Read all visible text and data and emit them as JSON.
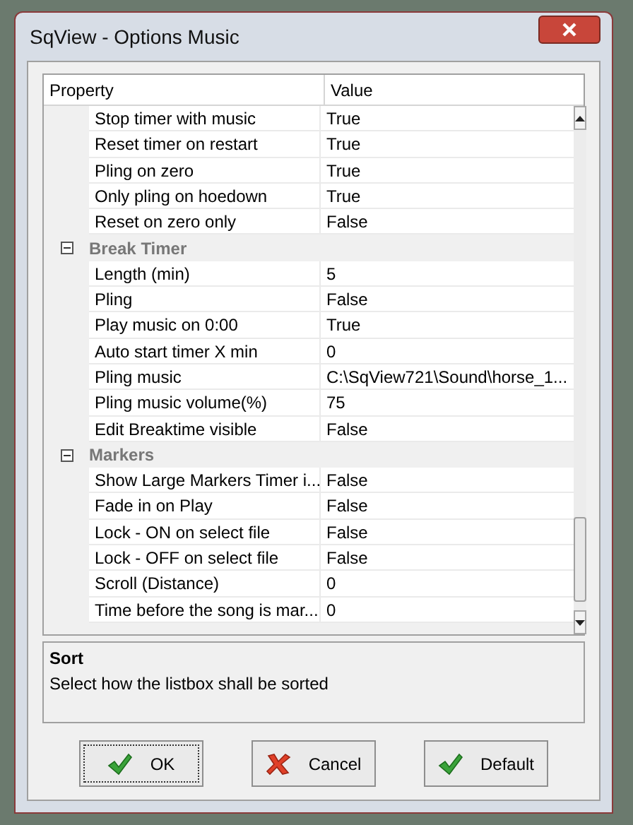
{
  "window": {
    "title": "SqView - Options Music"
  },
  "grid": {
    "columns": [
      "Property",
      "Value"
    ],
    "rows": [
      {
        "kind": "property",
        "name": "Stop timer with music",
        "value": "True"
      },
      {
        "kind": "property",
        "name": "Reset timer on restart",
        "value": "True"
      },
      {
        "kind": "property",
        "name": "Pling on zero",
        "value": "True"
      },
      {
        "kind": "property",
        "name": "Only pling on hoedown",
        "value": "True"
      },
      {
        "kind": "property",
        "name": "Reset on zero only",
        "value": "False"
      },
      {
        "kind": "category",
        "name": "Break Timer",
        "expanded": true
      },
      {
        "kind": "property",
        "name": "Length (min)",
        "value": "5"
      },
      {
        "kind": "property",
        "name": "Pling",
        "value": "False"
      },
      {
        "kind": "property",
        "name": "Play music on 0:00",
        "value": "True"
      },
      {
        "kind": "property",
        "name": "Auto start timer X min",
        "value": "0"
      },
      {
        "kind": "property",
        "name": "Pling music",
        "value": "C:\\SqView721\\Sound\\horse_1..."
      },
      {
        "kind": "property",
        "name": "Pling music volume(%)",
        "value": "75"
      },
      {
        "kind": "property",
        "name": "Edit Breaktime visible",
        "value": "False"
      },
      {
        "kind": "category",
        "name": "Markers",
        "expanded": true
      },
      {
        "kind": "property",
        "name": "Show Large Markers Timer i...",
        "value": "False"
      },
      {
        "kind": "property",
        "name": "Fade in on Play",
        "value": "False"
      },
      {
        "kind": "property",
        "name": "Lock - ON on select file",
        "value": "False"
      },
      {
        "kind": "property",
        "name": "Lock - OFF on select file",
        "value": "False"
      },
      {
        "kind": "property",
        "name": "Scroll (Distance)",
        "value": "0"
      },
      {
        "kind": "property",
        "name": "Time before the song is mar...",
        "value": "0"
      }
    ]
  },
  "description": {
    "title": "Sort",
    "text": "Select how the listbox shall be sorted"
  },
  "buttons": [
    {
      "label": "OK",
      "kind": "check",
      "focused": true
    },
    {
      "label": "Cancel",
      "kind": "cross",
      "focused": false
    },
    {
      "label": "Default",
      "kind": "check",
      "focused": false
    }
  ]
}
